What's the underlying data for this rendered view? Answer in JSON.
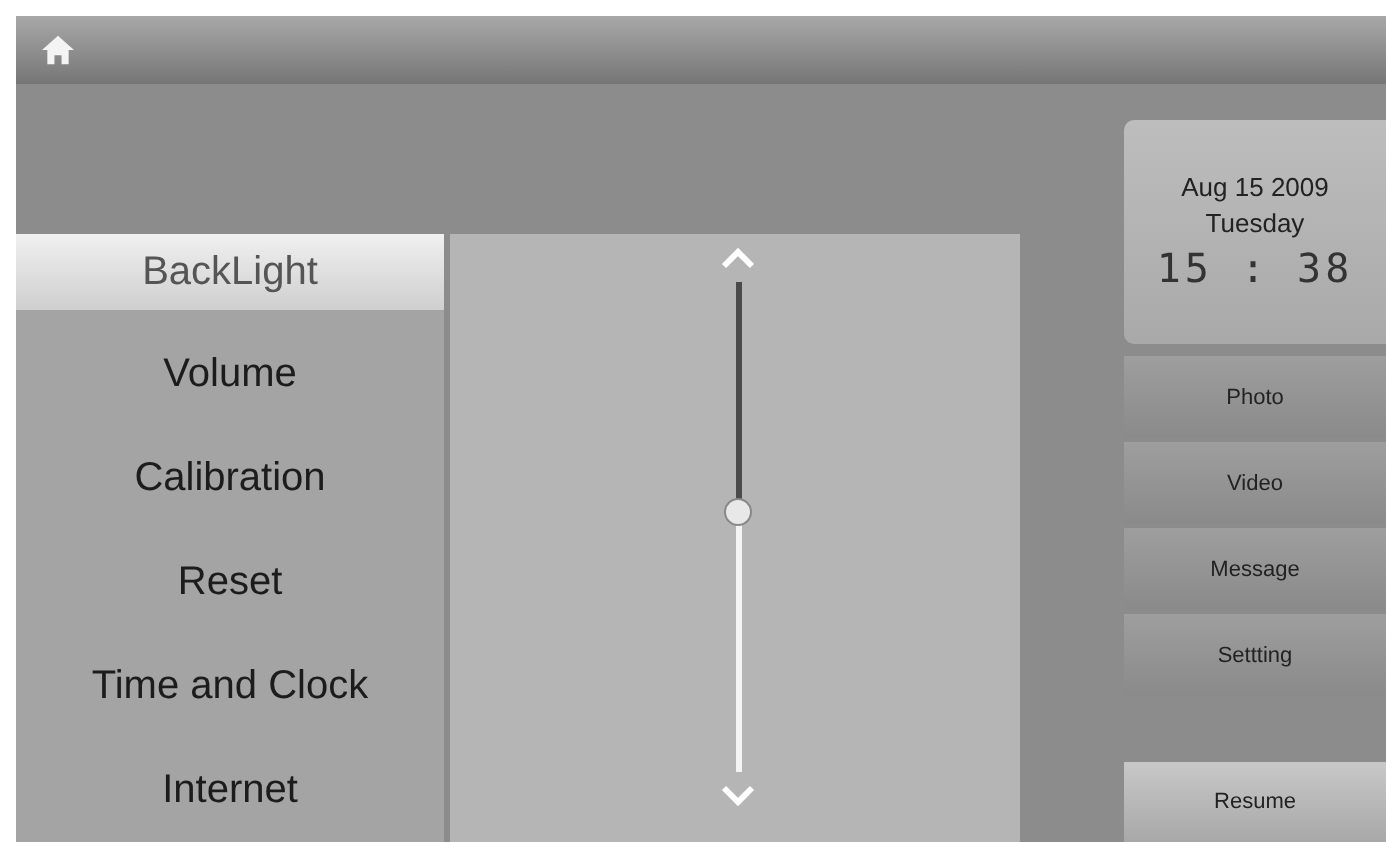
{
  "menu": [
    {
      "label": "BackLight",
      "selected": true
    },
    {
      "label": "Volume",
      "selected": false
    },
    {
      "label": "Calibration",
      "selected": false
    },
    {
      "label": "Reset",
      "selected": false
    },
    {
      "label": "Time and Clock",
      "selected": false
    },
    {
      "label": "Internet",
      "selected": false
    }
  ],
  "slider": {
    "level": 0.53
  },
  "clock": {
    "date": "Aug 15  2009",
    "weekday": "Tuesday",
    "time": "15 : 38"
  },
  "nav_buttons": [
    "Photo",
    "Video",
    "Message",
    "Settting"
  ],
  "resume_button": "Resume"
}
